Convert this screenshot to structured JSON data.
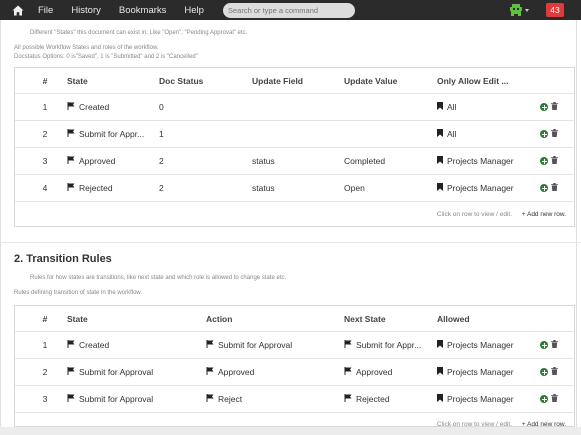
{
  "navbar": {
    "menu": [
      "File",
      "History",
      "Bookmarks",
      "Help"
    ],
    "search_placeholder": "Search or type a command",
    "notification_count": "43"
  },
  "states_section": {
    "intro": "Different \"States\" this document can exist in. Like \"Open\", \"Pending Approval\" etc.",
    "help_1": "All possible Workflow States and roles of the workflow.",
    "help_2": "Docstatus Options: 0 is\"Saved\", 1 is \"Submitted\" and 2 is \"Cancelled\"",
    "columns": [
      "#",
      "State",
      "Doc Status",
      "Update Field",
      "Update Value",
      "Only Allow Edit ..."
    ],
    "rows": [
      {
        "idx": "1",
        "state": "Created",
        "doc_status": "0",
        "update_field": "",
        "update_value": "",
        "allow_edit": "All"
      },
      {
        "idx": "2",
        "state": "Submit for Appr...",
        "doc_status": "1",
        "update_field": "",
        "update_value": "",
        "allow_edit": "All"
      },
      {
        "idx": "3",
        "state": "Approved",
        "doc_status": "2",
        "update_field": "status",
        "update_value": "Completed",
        "allow_edit": "Projects Manager"
      },
      {
        "idx": "4",
        "state": "Rejected",
        "doc_status": "2",
        "update_field": "status",
        "update_value": "Open",
        "allow_edit": "Projects Manager"
      }
    ],
    "footer_hint": "Click on row to view / edit.",
    "add_row": "+ Add new row."
  },
  "transitions_section": {
    "title": "2. Transition Rules",
    "intro": "Rules for how states are transitions, like next state and which role is allowed to change state etc.",
    "help": "Rules defining transition of state in the workflow.",
    "columns": [
      "#",
      "State",
      "Action",
      "Next State",
      "Allowed"
    ],
    "rows": [
      {
        "idx": "1",
        "state": "Created",
        "action": "Submit for Approval",
        "next_state": "Submit for Appr...",
        "allowed": "Projects Manager"
      },
      {
        "idx": "2",
        "state": "Submit for Approval",
        "action": "Approved",
        "next_state": "Approved",
        "allowed": "Projects Manager"
      },
      {
        "idx": "3",
        "state": "Submit for Approval",
        "action": "Reject",
        "next_state": "Rejected",
        "allowed": "Projects Manager"
      }
    ],
    "footer_hint": "Click on row to view / edit.",
    "add_row": "+ Add new row."
  }
}
